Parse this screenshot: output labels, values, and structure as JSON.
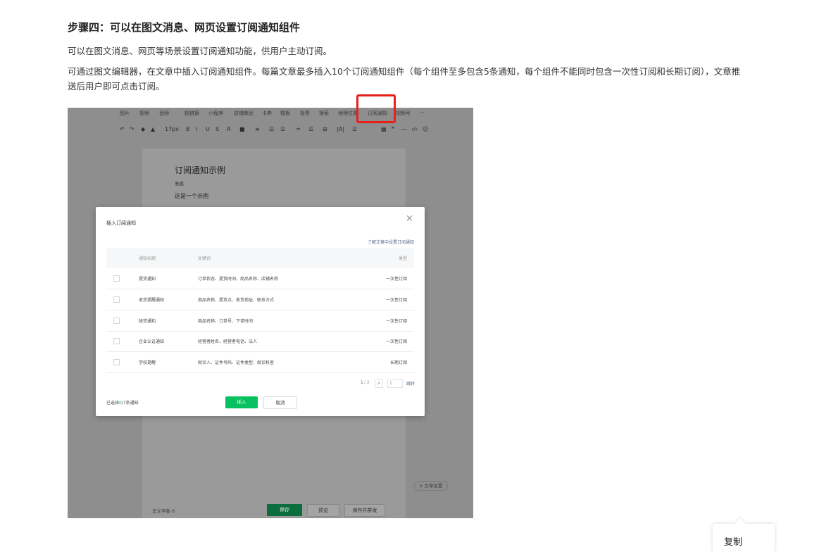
{
  "article": {
    "heading": "步骤四：可以在图文消息、网页设置订阅通知组件",
    "para1": "可以在图文消息、网页等场景设置订阅通知功能，供用户主动订阅。",
    "para2": "可通过图文编辑器，在文章中插入订阅通知组件。每篇文章最多插入10个订阅通知组件（每个组件至多包含5条通知，每个组件不能同时包含一次性订阅和长期订阅），文章推送后用户即可点击订阅。"
  },
  "editor": {
    "toolbar1": [
      "图片",
      "视频",
      "音频",
      "超链接",
      "小程序",
      "店铺商品",
      "卡券",
      "模板",
      "投票",
      "搜索",
      "地理位置",
      "订阅通知",
      "视频号",
      "···"
    ],
    "toolbar2": [
      "↶",
      "↷",
      "◆",
      "▲",
      "17px",
      "B",
      "I",
      "U",
      "S",
      "A",
      "■",
      "≡",
      "☰",
      "☰",
      "≐",
      "☰",
      "⊞",
      "|A|",
      "☰",
      "▦",
      "❞",
      "—",
      "‹/›",
      "☺"
    ],
    "article_title": "订阅通知示例",
    "author": "意嘉",
    "body": "这是一个示例",
    "word_count": "正文字数 6",
    "buttons": {
      "save": "保存",
      "preview": "预览",
      "save_send": "保存并群发"
    },
    "article_settings": "∨ 文章设置"
  },
  "dialog": {
    "title": "插入订阅通知",
    "close": "×",
    "help_link": "了解文章中设置订阅通知",
    "columns": [
      "通知标题",
      "关键词",
      "类型"
    ],
    "rows": [
      {
        "title": "提货通知",
        "keywords": "订单状态、提货时间、商品名称、店铺名称",
        "type": "一次性订阅"
      },
      {
        "title": "收货提醒通知",
        "keywords": "商品名称、提货点、收货地址、联系方式",
        "type": "一次性订阅"
      },
      {
        "title": "缺货通知",
        "keywords": "商品名称、订单号、下单时间",
        "type": "一次性订阅"
      },
      {
        "title": "企业认证通知",
        "keywords": "经营者姓名、经营者电话、法人",
        "type": "一次性订阅"
      },
      {
        "title": "学校提醒",
        "keywords": "就诊人、证件号码、证件类型、就诊科室",
        "type": "长期订阅"
      }
    ],
    "pager": {
      "page": "1",
      "total": "/ 2",
      "next": ">",
      "input": "1",
      "jump": "跳转"
    },
    "selected_prefix": "已选择",
    "selected_count": "0",
    "selected_total": "/7条通知",
    "insert": "插入",
    "cancel": "取消"
  },
  "context_menu": {
    "copy": "复制"
  }
}
